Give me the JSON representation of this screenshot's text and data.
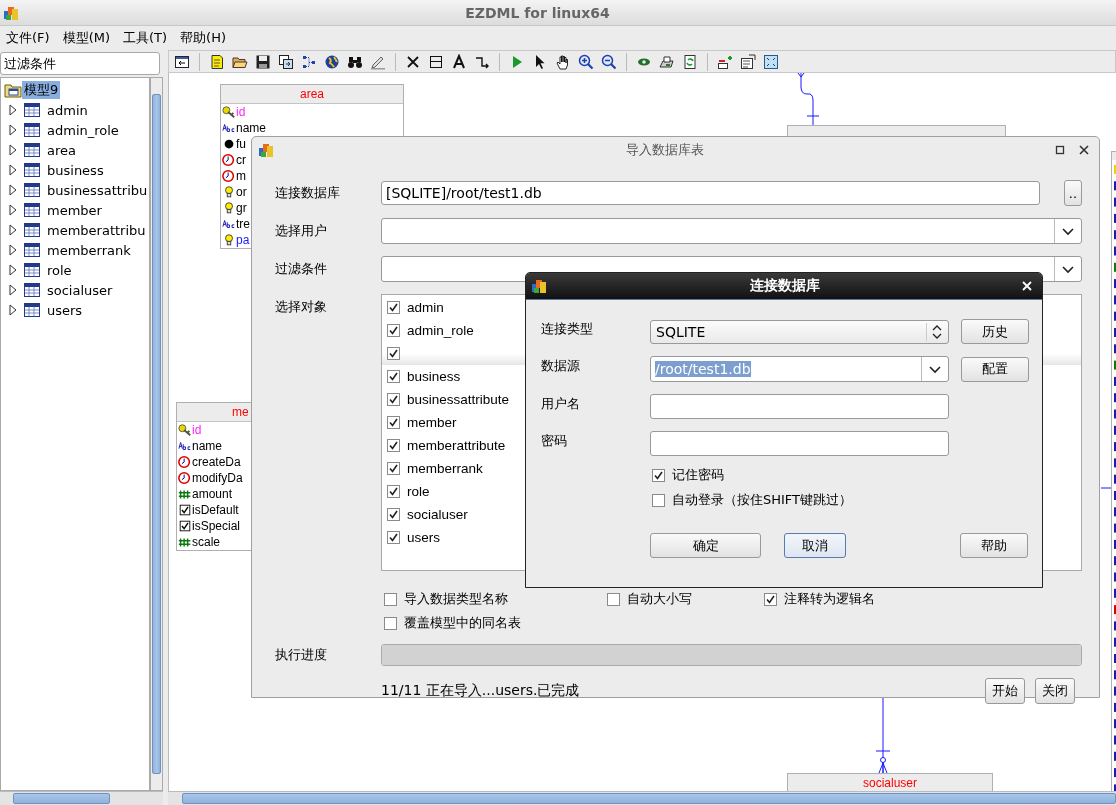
{
  "window": {
    "title": "EZDML for linux64"
  },
  "menu": [
    {
      "label": "文件(F)"
    },
    {
      "label": "模型(M)"
    },
    {
      "label": "工具(T)"
    },
    {
      "label": "帮助(H)"
    }
  ],
  "filter": {
    "value": "过滤条件"
  },
  "tree": {
    "root": {
      "label": "模型9",
      "selected": true,
      "children": [
        {
          "label": "admin",
          "expanded": false
        },
        {
          "label": "admin_role",
          "expanded": false
        },
        {
          "label": "area",
          "expanded": false
        },
        {
          "label": "business",
          "expanded": false
        },
        {
          "label": "businessattribu",
          "expanded": false
        },
        {
          "label": "member",
          "expanded": false
        },
        {
          "label": "memberattribu",
          "expanded": false
        },
        {
          "label": "memberrank",
          "expanded": false
        },
        {
          "label": "role",
          "expanded": false
        },
        {
          "label": "socialuser",
          "expanded": false
        },
        {
          "label": "users",
          "expanded": false
        }
      ]
    }
  },
  "diagram": {
    "tables": [
      {
        "title": "area",
        "fields": [
          {
            "kind": "key",
            "name": "id"
          },
          {
            "kind": "string",
            "name": "name"
          },
          {
            "kind": "dot",
            "name": "fu"
          },
          {
            "kind": "date",
            "name": "cr"
          },
          {
            "kind": "date",
            "name": "m"
          },
          {
            "kind": "index",
            "name": "or"
          },
          {
            "kind": "index",
            "name": "gr"
          },
          {
            "kind": "string",
            "name": "tre"
          },
          {
            "kind": "foreign",
            "name": "pa"
          }
        ]
      },
      {
        "title": "me",
        "fields": [
          {
            "kind": "key",
            "name": "id"
          },
          {
            "kind": "string",
            "name": "name"
          },
          {
            "kind": "date",
            "name": "createDa"
          },
          {
            "kind": "date",
            "name": "modifyDa"
          },
          {
            "kind": "number",
            "name": "amount"
          },
          {
            "kind": "bool",
            "name": "isDefault"
          },
          {
            "kind": "bool",
            "name": "isSpecial"
          },
          {
            "kind": "number",
            "name": "scale"
          }
        ]
      },
      {
        "title": "socialuser"
      }
    ]
  },
  "import_dialog": {
    "title": "导入数据库表",
    "rows": [
      {
        "label": "连接数据库",
        "kind": "text",
        "value": "[SQLITE]/root/test1.db",
        "button": ".."
      },
      {
        "label": "选择用户",
        "kind": "combo"
      },
      {
        "label": "过滤条件",
        "kind": "combo"
      }
    ],
    "objects_label": "选择对象",
    "objects": [
      {
        "label": "admin",
        "checked": true,
        "selected": false
      },
      {
        "label": "admin_role",
        "checked": true,
        "selected": false
      },
      {
        "checked": true,
        "selected": true
      },
      {
        "label": "business",
        "checked": true,
        "selected": false
      },
      {
        "label": "businessattribute",
        "checked": true,
        "selected": false
      },
      {
        "label": "member",
        "checked": true,
        "selected": false
      },
      {
        "label": "memberattribute",
        "checked": true,
        "selected": false
      },
      {
        "label": "memberrank",
        "checked": true,
        "selected": false
      },
      {
        "label": "role",
        "checked": true,
        "selected": false
      },
      {
        "label": "socialuser",
        "checked": true,
        "selected": false
      },
      {
        "label": "users",
        "checked": true,
        "selected": false
      }
    ],
    "options": [
      {
        "label": "导入数据类型名称",
        "checked": false
      },
      {
        "label": "自动大小写",
        "checked": false
      },
      {
        "label": "注释转为逻辑名",
        "checked": true
      },
      {
        "label": "覆盖模型中的同名表",
        "checked": false
      }
    ],
    "progress_label": "执行进度",
    "progress": {
      "level": 1
    },
    "status": "11/11 正在导入...users.已完成",
    "buttons": [
      {
        "label": "开始"
      },
      {
        "label": "关闭"
      }
    ]
  },
  "connect_dialog": {
    "title": "连接数据库",
    "fields": [
      {
        "label": "连接类型",
        "kind": "select",
        "value": "SQLITE",
        "button": "历史"
      },
      {
        "label": "数据源",
        "kind": "combo",
        "value": "/root/test1.db",
        "value_selected": true,
        "button": "配置"
      },
      {
        "label": "用户名",
        "kind": "input"
      },
      {
        "label": "密码",
        "kind": "input"
      }
    ],
    "options": [
      {
        "label": "记住密码",
        "checked": true
      },
      {
        "label": "自动登录（按住SHIFT键跳过）",
        "checked": false
      }
    ],
    "buttons": [
      {
        "label": "确定",
        "focused": false
      },
      {
        "label": "取消",
        "focused": true
      },
      {
        "label": "帮助",
        "focused": false
      }
    ]
  }
}
